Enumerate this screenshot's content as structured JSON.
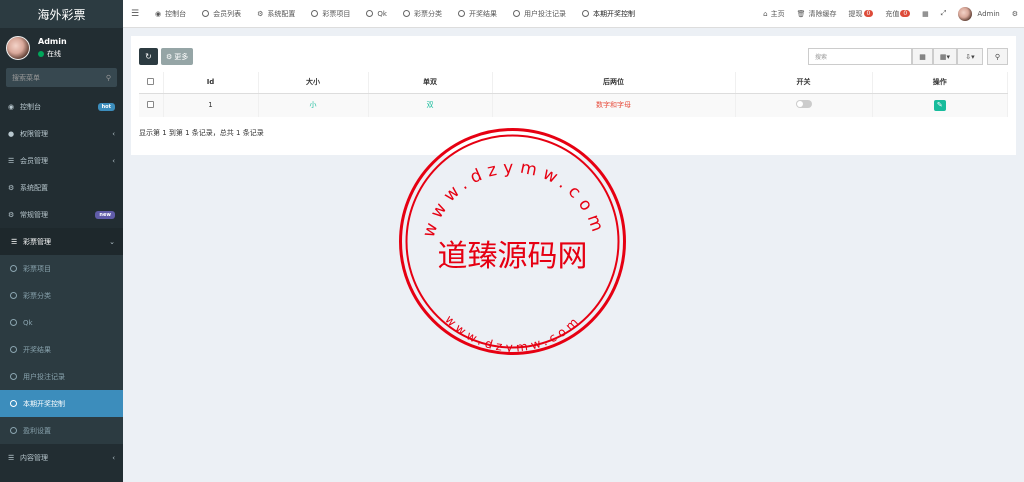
{
  "sidebar": {
    "logo": "海外彩票",
    "user": {
      "name": "Admin",
      "status": "在线"
    },
    "search_placeholder": "搜索菜单",
    "items": [
      {
        "label": "控制台",
        "badge": "hot"
      },
      {
        "label": "权限管理"
      },
      {
        "label": "会员管理"
      },
      {
        "label": "系统配置"
      },
      {
        "label": "常规管理",
        "badge": "new"
      },
      {
        "label": "彩票管理"
      }
    ],
    "sub_items": [
      "彩票项目",
      "彩票分类",
      "Qk",
      "开奖结果",
      "用户投注记录",
      "本期开奖控制",
      "盈利设置"
    ],
    "last_item": "内容管理"
  },
  "topnav": {
    "tabs": [
      "控制台",
      "会员列表",
      "系统配置",
      "彩票项目",
      "Qk",
      "彩票分类",
      "开奖结果",
      "用户投注记录",
      "本期开奖控制"
    ],
    "home": "主页",
    "clear_cache": "清除缓存",
    "withdraw": "提现",
    "withdraw_count": "0",
    "recharge": "充值",
    "recharge_count": "0",
    "admin": "Admin"
  },
  "toolbar": {
    "more_label": "更多",
    "search_placeholder": "搜索"
  },
  "table": {
    "headers": [
      "Id",
      "大小",
      "单双",
      "后两位",
      "开关",
      "操作"
    ],
    "rows": [
      {
        "id": "1",
        "size": "小",
        "parity": "双",
        "last_two": "数字和字母"
      }
    ],
    "summary": "显示第 1 到第 1 条记录，总共 1 条记录"
  },
  "watermark": {
    "center": "道臻源码网",
    "ring": "www.dzymw.com"
  },
  "colors": {
    "sidebar_bg": "#222d32",
    "active_blue": "#3c8dbc",
    "accent_green": "#18bc9c",
    "stamp_red": "#e60012"
  }
}
